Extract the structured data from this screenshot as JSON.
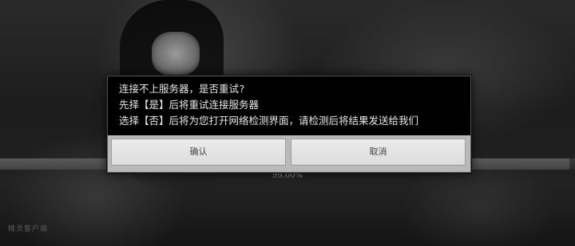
{
  "dialog": {
    "lines": [
      "连接不上服务器，是否重试?",
      "先择【是】后将重试连接服务器",
      "选择【否】后将为您打开网络检测界面，请检测后将结果发送给我们"
    ],
    "confirm_label": "确认",
    "cancel_label": "取消"
  },
  "loading": {
    "progress_text": "99.00%",
    "progress_fraction": 0.99
  },
  "watermark": "精灵客户端"
}
